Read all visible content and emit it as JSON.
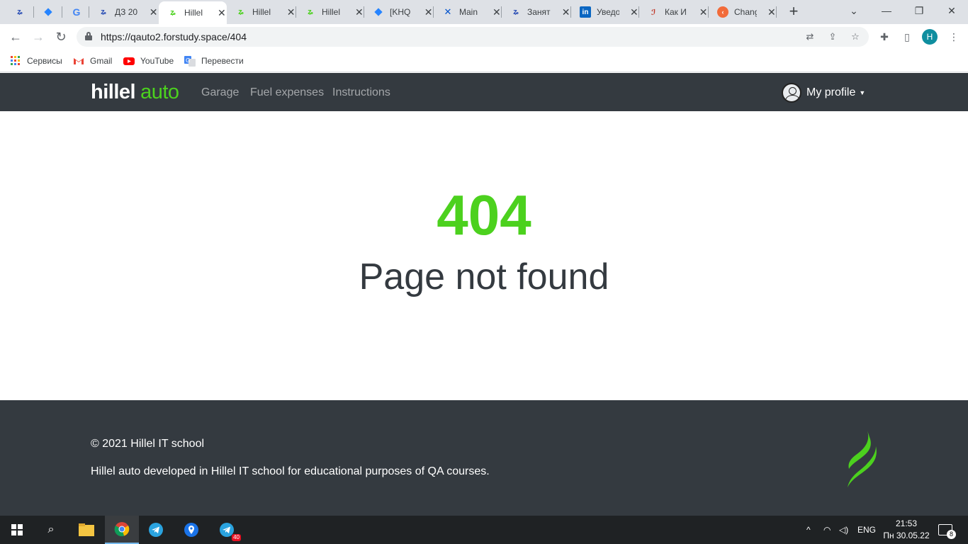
{
  "browser": {
    "tabs": [
      {
        "title": "",
        "active": false
      },
      {
        "title": "",
        "active": false
      },
      {
        "title": "",
        "active": false
      },
      {
        "title": "ДЗ 20",
        "active": false
      },
      {
        "title": "Hillel",
        "active": true
      },
      {
        "title": "Hillel",
        "active": false
      },
      {
        "title": "Hillel",
        "active": false
      },
      {
        "title": "[KHQ",
        "active": false
      },
      {
        "title": "Main",
        "active": false
      },
      {
        "title": "Занят",
        "active": false
      },
      {
        "title": "Уведо",
        "active": false
      },
      {
        "title": "Как И",
        "active": false
      },
      {
        "title": "Chang",
        "active": false
      }
    ],
    "new_tab": "+",
    "url": "https://qauto2.forstudy.space/404",
    "profile_initial": "H",
    "bookmarks": [
      "Сервисы",
      "Gmail",
      "YouTube",
      "Перевести"
    ]
  },
  "site": {
    "logo_white": "hillel",
    "logo_green": "auto",
    "nav": [
      "Garage",
      "Fuel expenses",
      "Instructions"
    ],
    "profile_label": "My profile",
    "accent_color": "#4cd11e",
    "header_color": "#343a40"
  },
  "main": {
    "error_code": "404",
    "error_message": "Page not found"
  },
  "footer": {
    "copyright": "© 2021 Hillel IT school",
    "description": "Hillel auto developed in Hillel IT school for educational purposes of QA courses."
  },
  "taskbar": {
    "lang": "ENG",
    "time": "21:53",
    "date": "Пн 30.05.22",
    "telegram_badge": "40",
    "notifications": "8"
  }
}
